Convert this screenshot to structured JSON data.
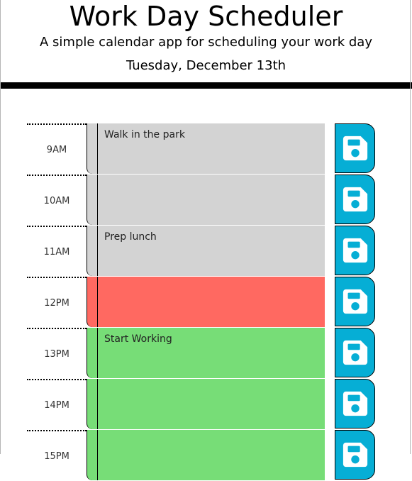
{
  "header": {
    "title": "Work Day Scheduler",
    "subtitle": "A simple calendar app for scheduling your work day",
    "date": "Tuesday, December 13th"
  },
  "colors": {
    "past": "#d3d3d3",
    "present": "#ff6961",
    "future": "#77dd77",
    "save_button": "#06aed5"
  },
  "time_blocks": [
    {
      "hour": "9AM",
      "text": "Walk in the park",
      "state": "past"
    },
    {
      "hour": "10AM",
      "text": "",
      "state": "past"
    },
    {
      "hour": "11AM",
      "text": "Prep lunch",
      "state": "past"
    },
    {
      "hour": "12PM",
      "text": "",
      "state": "present"
    },
    {
      "hour": "13PM",
      "text": "Start Working",
      "state": "future"
    },
    {
      "hour": "14PM",
      "text": "",
      "state": "future"
    },
    {
      "hour": "15PM",
      "text": "",
      "state": "future"
    }
  ],
  "save_icon": "floppy-disk-icon"
}
